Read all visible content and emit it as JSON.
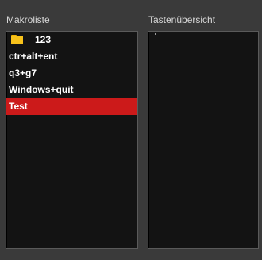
{
  "panels": {
    "macro_list": {
      "label": "Makroliste",
      "items": [
        {
          "label": "123",
          "icon": "folder-icon",
          "selected": false
        },
        {
          "label": "ctr+alt+ent",
          "selected": false
        },
        {
          "label": "q3+g7",
          "selected": false
        },
        {
          "label": "Windows+quit",
          "selected": false
        },
        {
          "label": "Test",
          "selected": true
        }
      ]
    },
    "key_overview": {
      "label": "Tastenübersicht"
    }
  },
  "colors": {
    "background": "#3a3a3a",
    "list_background": "#131313",
    "selection": "#cc1a1a",
    "folder": "#f7c21b"
  }
}
